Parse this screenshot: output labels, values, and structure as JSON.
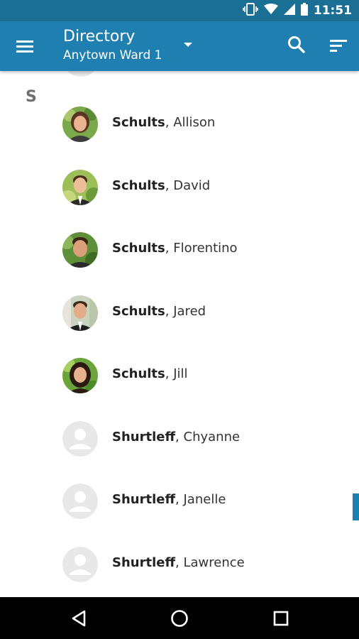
{
  "status_bar": {
    "time": "11:51",
    "icons": [
      "vibrate-icon",
      "wifi-icon",
      "signal-icon",
      "battery-icon"
    ]
  },
  "app_bar": {
    "title": "Directory",
    "subtitle": "Anytown Ward 1",
    "icons": [
      "menu-icon",
      "dropdown-arrow-icon",
      "search-icon",
      "sort-icon"
    ]
  },
  "section": {
    "letter": "S"
  },
  "contacts": [
    {
      "last": "Schults",
      "first": "Allison",
      "photo": true
    },
    {
      "last": "Schults",
      "first": "David",
      "photo": true
    },
    {
      "last": "Schults",
      "first": "Florentino",
      "photo": true
    },
    {
      "last": "Schults",
      "first": "Jared",
      "photo": true
    },
    {
      "last": "Schults",
      "first": "Jill",
      "photo": true
    },
    {
      "last": "Shurtleff",
      "first": "Chyanne",
      "photo": false
    },
    {
      "last": "Shurtleff",
      "first": "Janelle",
      "photo": false
    },
    {
      "last": "Shurtleff",
      "first": "Lawrence",
      "photo": false
    }
  ],
  "nav_bar": {
    "icons": [
      "back-icon",
      "home-icon",
      "recents-icon"
    ]
  },
  "colors": {
    "primary": "#1f7fb0",
    "status_bar": "#1b6f94",
    "placeholder_avatar": "#e8e8e8"
  }
}
